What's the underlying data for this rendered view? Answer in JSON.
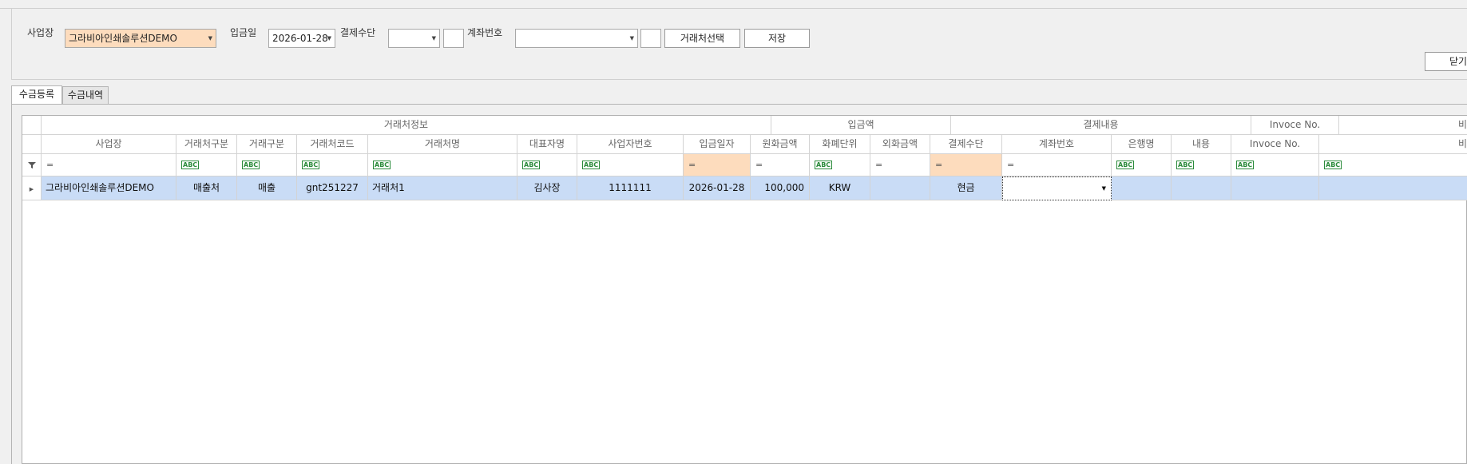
{
  "toolbar": {
    "site_label": "사업장",
    "site_value": "그라비아인쇄솔루션DEMO",
    "deposit_date_label": "입금일",
    "deposit_date_value": "2026-01-28",
    "payment_method_label": "결제수단",
    "payment_method_value": "",
    "account_label": "계좌번호",
    "account_value": "",
    "select_client_button": "거래처선택",
    "save_button": "저장",
    "close_button": "닫기"
  },
  "tabs": [
    {
      "label": "수금등록",
      "active": true
    },
    {
      "label": "수금내역",
      "active": false
    }
  ],
  "grid": {
    "bands": [
      "거래처정보",
      "입금액",
      "결제내용",
      "Invoce No.",
      "비"
    ],
    "columns": [
      "사업장",
      "거래처구분",
      "거래구분",
      "거래처코드",
      "거래처명",
      "대표자명",
      "사업자번호",
      "입금일자",
      "원화금액",
      "화폐단위",
      "외화금액",
      "결제수단",
      "계좌번호",
      "은행명",
      "내용",
      "Invoce No.",
      "비"
    ],
    "filter_equal": "=",
    "filter_abc": "ABC",
    "rows": [
      {
        "site": "그라비아인쇄솔루션DEMO",
        "client_type": "매출처",
        "trade_type": "매출",
        "client_code": "gnt251227",
        "client_name": "거래처1",
        "ceo_name": "김사장",
        "biz_no": "1111111",
        "deposit_date": "2026-01-28",
        "krw_amount": "100,000",
        "currency": "KRW",
        "foreign_amount": "",
        "payment_method": "현금",
        "account_no": "",
        "bank_name": "",
        "memo": "",
        "invoice_no": "",
        "extra": ""
      }
    ]
  },
  "colors": {
    "highlight_orange": "#fddcbd",
    "selected_row": "#c9dcf6",
    "abc_icon_green": "#2a8a3a"
  }
}
